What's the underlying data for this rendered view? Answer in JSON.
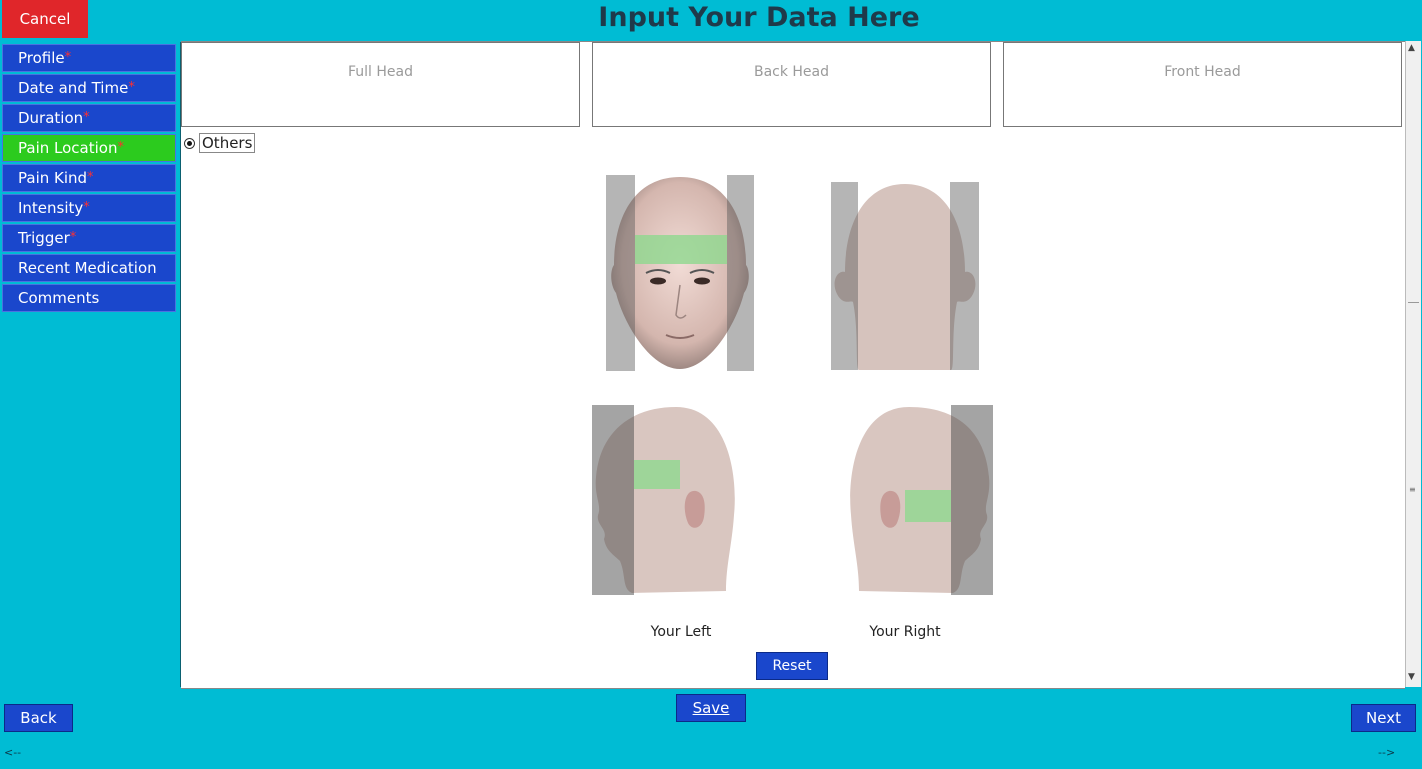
{
  "header": {
    "title": "Input Your Data Here",
    "cancel_label": "Cancel"
  },
  "sidebar": {
    "items": [
      {
        "label": "Profile",
        "required": "*"
      },
      {
        "label": "Date and Time",
        "required": "*"
      },
      {
        "label": "Duration",
        "required": "*"
      },
      {
        "label": "Pain Location",
        "required": "*"
      },
      {
        "label": "Pain Kind",
        "required": "*"
      },
      {
        "label": "Intensity",
        "required": "*"
      },
      {
        "label": "Trigger",
        "required": "*"
      },
      {
        "label": "Recent Medication",
        "required": ""
      },
      {
        "label": "Comments",
        "required": ""
      }
    ],
    "active_index": 3
  },
  "location_options": {
    "full_head": "Full Head",
    "back_head": "Back Head",
    "front_head": "Front Head",
    "others": "Others"
  },
  "head_views": {
    "your_left": "Your Left",
    "your_right": "Your Right"
  },
  "buttons": {
    "reset": "Reset",
    "save": "Save",
    "back": "Back",
    "next": "Next"
  },
  "nav_arrows": {
    "left": "<--",
    "right": "-->"
  },
  "colors": {
    "background": "#00bcd4",
    "nav_blue": "#1a47cc",
    "active_green": "#2ccb1e",
    "cancel_red": "#e0262a",
    "highlight_green": "#8ed88e"
  }
}
